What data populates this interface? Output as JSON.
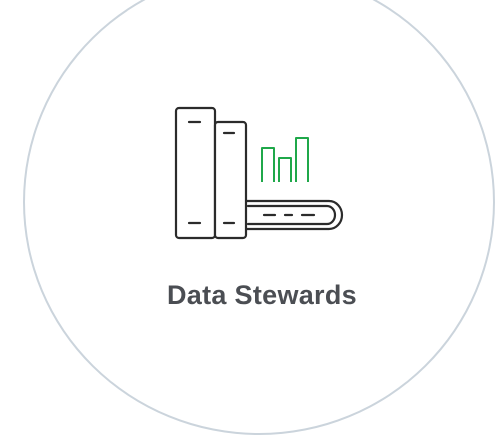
{
  "card": {
    "title": "Data Stewards",
    "icon": "books-with-bar-chart-icon"
  },
  "colors": {
    "circle_border": "#cbd4dc",
    "icon_stroke": "#2b2b2b",
    "chart_accent": "#1fa84a",
    "title_text": "#4b4e53"
  }
}
